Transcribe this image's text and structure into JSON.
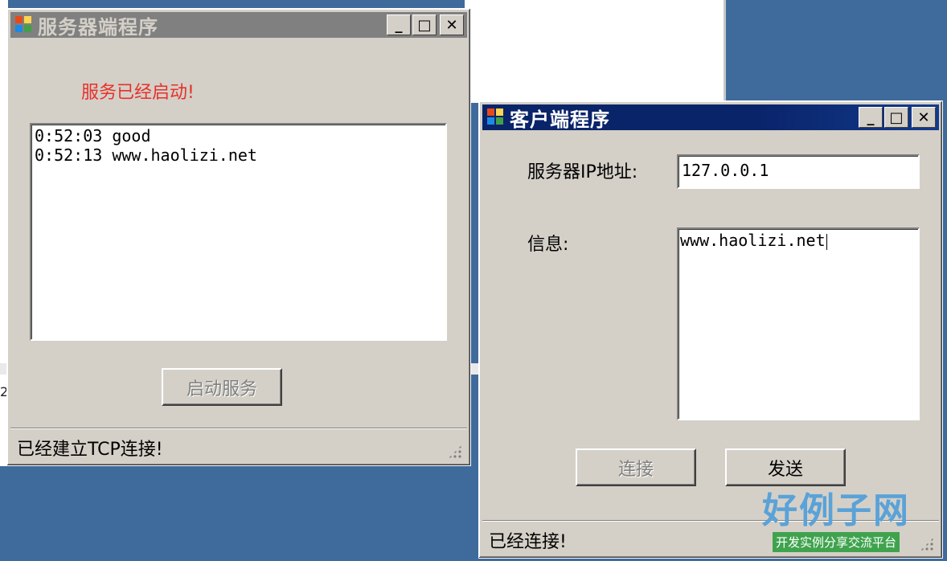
{
  "server_window": {
    "title": "服务器端程序",
    "status_label": "服务已经启动!",
    "log_lines": [
      "0:52:03 good",
      "0:52:13 www.haolizi.net"
    ],
    "start_button": "启动服务",
    "status_bar": "已经建立TCP连接!"
  },
  "client_window": {
    "title": "客户端程序",
    "ip_label": "服务器IP地址:",
    "ip_value": "127.0.0.1",
    "message_label": "信息:",
    "message_value": "www.haolizi.net",
    "connect_button": "连接",
    "send_button": "发送",
    "status_bar": "已经连接!"
  },
  "titlebar_buttons": {
    "minimize": "_",
    "maximize": "□",
    "close": "✕"
  },
  "background": {
    "fragment": "2"
  },
  "watermark": {
    "main": "好例子网",
    "sub": "开发实例分享交流平台"
  },
  "colors": {
    "status_red": "#e8302a",
    "active_title": "#0a246a",
    "inactive_title": "#808080",
    "desktop": "#3f6a9c"
  }
}
